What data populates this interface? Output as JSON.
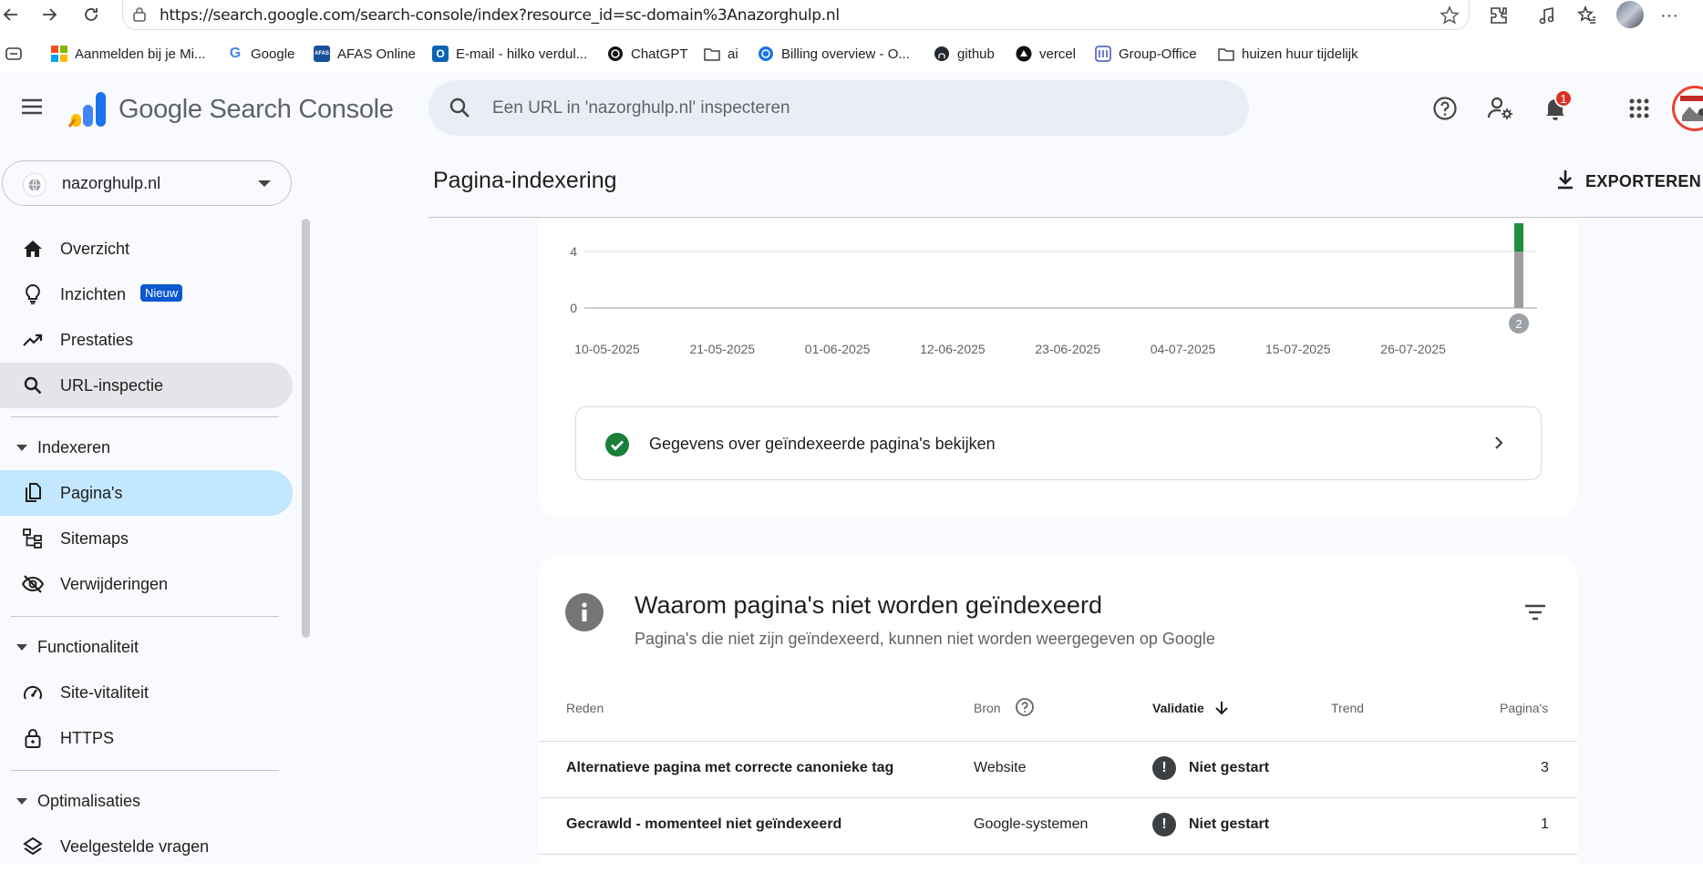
{
  "browser": {
    "url": "https://search.google.com/search-console/index?resource_id=sc-domain%3Anazorghulp.nl",
    "bookmarks": [
      {
        "label": "Aanmelden bij je Mi...",
        "icon": "microsoft-icon"
      },
      {
        "label": "Google",
        "icon": "google-icon"
      },
      {
        "label": "AFAS Online",
        "icon": "afas-icon"
      },
      {
        "label": "E-mail - hilko verdul...",
        "icon": "outlook-icon"
      },
      {
        "label": "ChatGPT",
        "icon": "chatgpt-icon"
      },
      {
        "label": "ai",
        "icon": "folder-icon"
      },
      {
        "label": "Billing overview - O...",
        "icon": "openai-icon"
      },
      {
        "label": "github",
        "icon": "github-icon"
      },
      {
        "label": "vercel",
        "icon": "vercel-icon"
      },
      {
        "label": "Group-Office",
        "icon": "group-office-icon"
      },
      {
        "label": "huizen huur tijdelijk",
        "icon": "folder-icon"
      }
    ]
  },
  "header": {
    "brand": "Google Search Console",
    "search_placeholder": "Een URL in 'nazorghulp.nl' inspecteren",
    "notification_count": "1"
  },
  "sidebar": {
    "property": "nazorghulp.nl",
    "items": [
      {
        "label": "Overzicht",
        "icon": "home-icon"
      },
      {
        "label": "Inzichten",
        "icon": "lightbulb-icon",
        "badge": "Nieuw"
      },
      {
        "label": "Prestaties",
        "icon": "trending-up-icon"
      },
      {
        "label": "URL-inspectie",
        "icon": "search-icon"
      }
    ],
    "sections": [
      {
        "label": "Indexeren",
        "items": [
          {
            "label": "Pagina's",
            "icon": "pages-icon"
          },
          {
            "label": "Sitemaps",
            "icon": "sitemap-icon"
          },
          {
            "label": "Verwijderingen",
            "icon": "visibility-off-icon"
          }
        ]
      },
      {
        "label": "Functionaliteit",
        "items": [
          {
            "label": "Site-vitaliteit",
            "icon": "speed-icon"
          },
          {
            "label": "HTTPS",
            "icon": "lock-icon"
          }
        ]
      },
      {
        "label": "Optimalisaties",
        "items": [
          {
            "label": "Veelgestelde vragen",
            "icon": "layers-icon"
          }
        ]
      }
    ]
  },
  "main": {
    "title": "Pagina-indexering",
    "export_label": "EXPORTEREN",
    "indexed_link": "Gegevens over geïndexeerde pagina's bekijken",
    "reasons_card": {
      "title": "Waarom pagina's niet worden geïndexeerd",
      "subtitle": "Pagina's die niet zijn geïndexeerd, kunnen niet worden weergegeven op Google",
      "columns": [
        "Reden",
        "Bron",
        "Validatie",
        "Trend",
        "Pagina's"
      ],
      "rows": [
        {
          "reason": "Alternatieve pagina met correcte canonieke tag",
          "source": "Website",
          "validation": "Niet gestart",
          "pages": "3"
        },
        {
          "reason": "Gecrawld - momenteel niet geïndexeerd",
          "source": "Google-systemen",
          "validation": "Niet gestart",
          "pages": "1"
        }
      ]
    }
  },
  "chart_data": {
    "type": "bar",
    "x_tick_labels": [
      "10-05-2025",
      "21-05-2025",
      "01-06-2025",
      "12-06-2025",
      "23-06-2025",
      "04-07-2025",
      "15-07-2025",
      "26-07-2025"
    ],
    "y_tick_labels": [
      "4",
      "0"
    ],
    "series": [
      {
        "color": "#9e9e9e",
        "values": [
          4
        ]
      },
      {
        "color": "#1e8e3e",
        "values": [
          2
        ]
      }
    ],
    "annotation": "2",
    "colors": {
      "not_indexed": "#9e9e9e",
      "indexed": "#1e8e3e"
    }
  }
}
